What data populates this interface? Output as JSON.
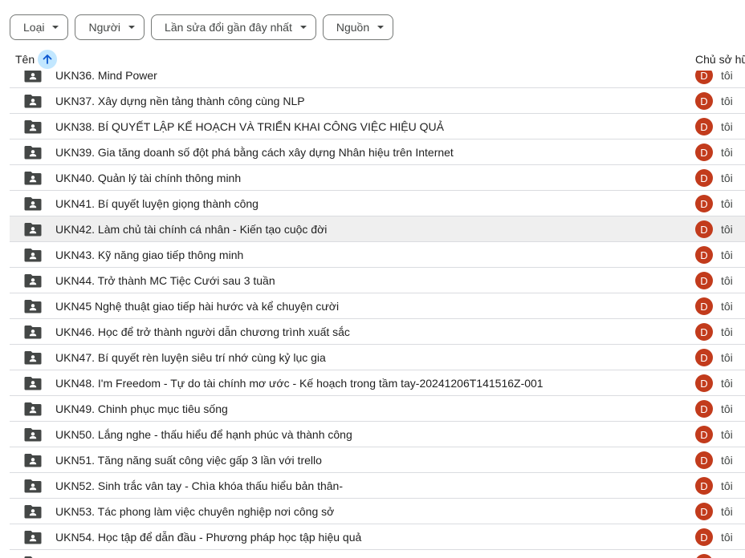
{
  "filters": {
    "type": "Loại",
    "people": "Người",
    "modified": "Lần sửa đổi gần đây nhất",
    "source": "Nguồn"
  },
  "header": {
    "name": "Tên",
    "owner": "Chủ sở hữ"
  },
  "colors": {
    "avatar": "#c23b1c",
    "sort_bg": "#c2e7ff",
    "row_highlight": "#efefef"
  },
  "rows": [
    {
      "name": "UKN36. Mind Power",
      "avatar": "D",
      "owner": "tôi"
    },
    {
      "name": "UKN37. Xây dựng nền tảng thành công cùng NLP",
      "avatar": "D",
      "owner": "tôi"
    },
    {
      "name": "UKN38. BÍ QUYẾT LẬP KẾ HOẠCH VÀ TRIỂN KHAI CÔNG VIỆC HIỆU QUẢ",
      "avatar": "D",
      "owner": "tôi"
    },
    {
      "name": "UKN39. Gia tăng doanh số đột phá bằng cách xây dựng Nhân hiệu trên Internet",
      "avatar": "D",
      "owner": "tôi"
    },
    {
      "name": "UKN40. Quản lý tài chính thông minh",
      "avatar": "D",
      "owner": "tôi"
    },
    {
      "name": "UKN41. Bí quyết luyện giọng thành công",
      "avatar": "D",
      "owner": "tôi"
    },
    {
      "name": "UKN42. Làm chủ tài chính cá nhân - Kiến tạo cuộc đời",
      "avatar": "D",
      "owner": "tôi"
    },
    {
      "name": "UKN43. Kỹ năng giao tiếp thông minh",
      "avatar": "D",
      "owner": "tôi"
    },
    {
      "name": "UKN44. Trở thành MC Tiệc Cưới sau 3 tuần",
      "avatar": "D",
      "owner": "tôi"
    },
    {
      "name": "UKN45 Nghệ thuật giao tiếp hài hước và kể chuyện cười",
      "avatar": "D",
      "owner": "tôi"
    },
    {
      "name": "UKN46. Học để trở thành người dẫn chương trình xuất sắc",
      "avatar": "D",
      "owner": "tôi"
    },
    {
      "name": "UKN47. Bí quyết rèn luyện siêu trí nhớ cùng kỷ lục gia",
      "avatar": "D",
      "owner": "tôi"
    },
    {
      "name": "UKN48. I'm Freedom - Tự do tài chính mơ ước - Kế hoạch trong tầm tay-20241206T141516Z-001",
      "avatar": "D",
      "owner": "tôi"
    },
    {
      "name": "UKN49. Chinh phục mục tiêu sống",
      "avatar": "D",
      "owner": "tôi"
    },
    {
      "name": "UKN50. Lắng nghe - thấu hiểu để hạnh phúc và thành công",
      "avatar": "D",
      "owner": "tôi"
    },
    {
      "name": "UKN51. Tăng năng suất công việc gấp 3 lần với trello",
      "avatar": "D",
      "owner": "tôi"
    },
    {
      "name": "UKN52. Sinh trắc vân tay - Chìa khóa thấu hiểu bản thân-",
      "avatar": "D",
      "owner": "tôi"
    },
    {
      "name": "UKN53. Tác phong làm việc chuyên nghiệp nơi công sở",
      "avatar": "D",
      "owner": "tôi"
    },
    {
      "name": "UKN54. Học tập để dẫn đầu - Phương pháp học tập hiệu quả",
      "avatar": "D",
      "owner": "tôi"
    },
    {
      "name": "",
      "avatar": "D",
      "owner": ""
    }
  ]
}
